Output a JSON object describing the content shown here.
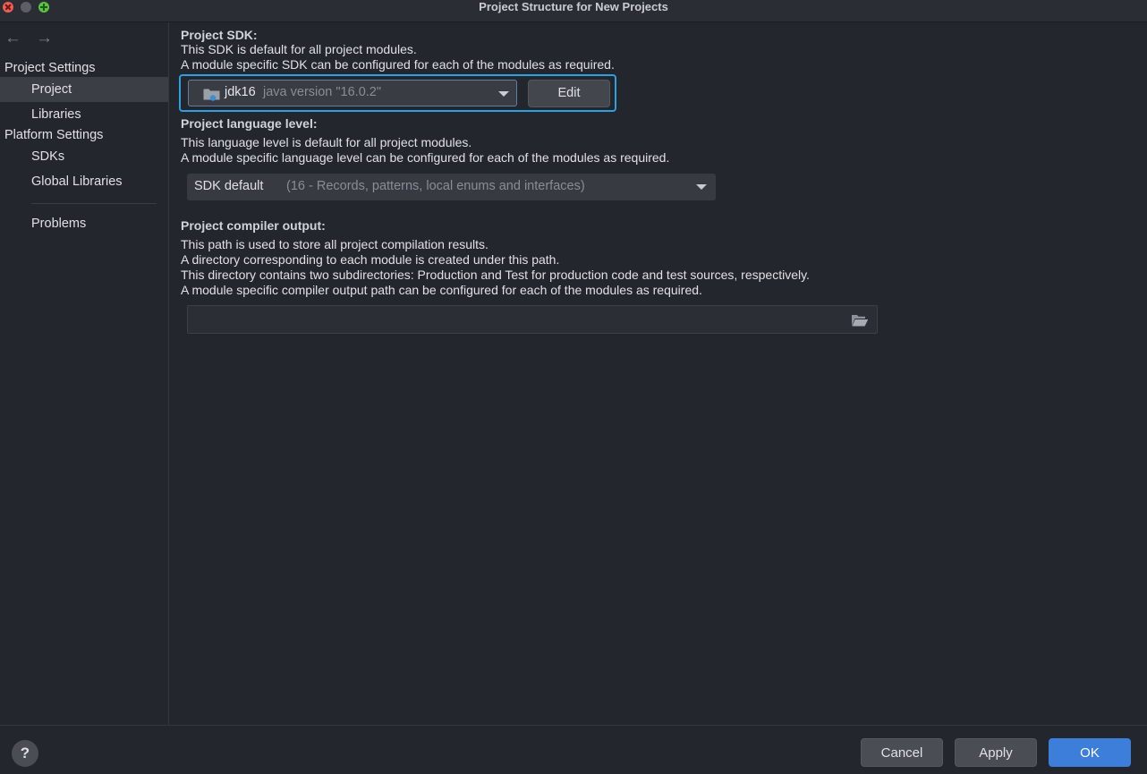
{
  "window": {
    "title": "Project Structure for New Projects"
  },
  "nav": {
    "back_icon": "arrow-left-icon",
    "forward_icon": "arrow-right-icon"
  },
  "sidebar": {
    "project_settings_header": "Project Settings",
    "project_settings_items": [
      {
        "label": "Project",
        "selected": true
      },
      {
        "label": "Libraries"
      }
    ],
    "platform_settings_header": "Platform Settings",
    "platform_settings_items": [
      {
        "label": "SDKs"
      },
      {
        "label": "Global Libraries"
      }
    ],
    "problems_label": "Problems"
  },
  "main": {
    "sdk": {
      "title": "Project SDK:",
      "desc1": "This SDK is default for all project modules.",
      "desc2": "A module specific SDK can be configured for each of the modules as required.",
      "selected_name": "jdk16",
      "selected_version": "java version \"16.0.2\"",
      "edit_label": "Edit"
    },
    "language": {
      "title": "Project language level:",
      "desc1": "This language level is default for all project modules.",
      "desc2": "A module specific language level can be configured for each of the modules as required.",
      "selected_value": "SDK default",
      "selected_hint": "(16 - Records, patterns, local enums and interfaces)"
    },
    "compiler": {
      "title": "Project compiler output:",
      "desc1": "This path is used to store all project compilation results.",
      "desc2": "A directory corresponding to each module is created under this path.",
      "desc3": "This directory contains two subdirectories: Production and Test for production code and test sources, respectively.",
      "desc4": "A module specific compiler output path can be configured for each of the modules as required.",
      "output_path": ""
    }
  },
  "footer": {
    "help_label": "?",
    "cancel_label": "Cancel",
    "apply_label": "Apply",
    "ok_label": "OK"
  },
  "colors": {
    "background": "#23262d",
    "focus_ring": "#2e9fe0",
    "primary_button": "#3d7edb",
    "selection": "#3b3e45"
  }
}
